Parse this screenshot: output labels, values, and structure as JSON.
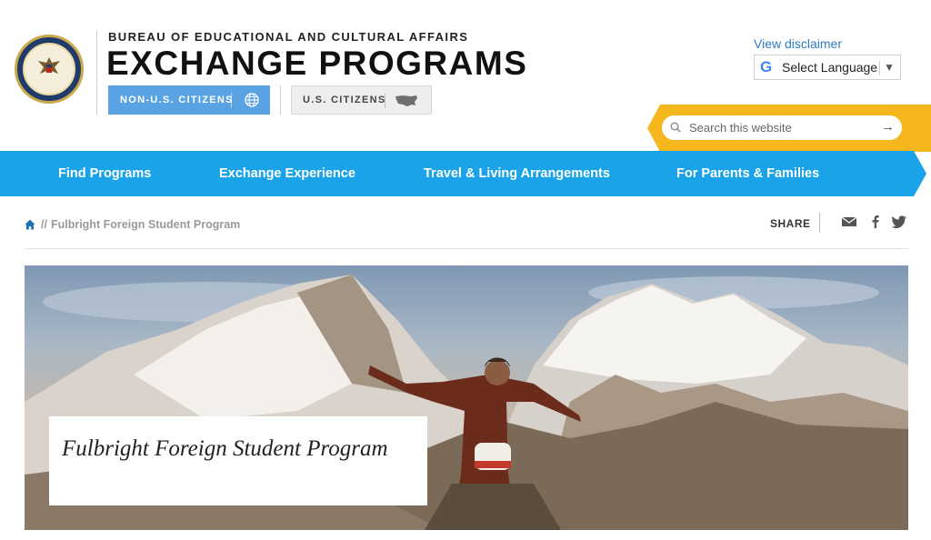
{
  "header": {
    "bureau": "BUREAU OF EDUCATIONAL AND CULTURAL AFFAIRS",
    "title": "EXCHANGE PROGRAMS",
    "audience_buttons": [
      {
        "label": "NON-U.S. CITIZENS",
        "icon": "globe-icon",
        "active": true
      },
      {
        "label": "U.S. CITIZENS",
        "icon": "usa-map-icon",
        "active": false
      }
    ],
    "disclaimer": "View disclaimer",
    "language": {
      "label": "Select Language",
      "icon": "google-icon",
      "arrow": "▼"
    },
    "search": {
      "placeholder": "Search this website",
      "icon": "search-icon",
      "submit_icon": "arrow-right-icon"
    }
  },
  "nav": {
    "items": [
      {
        "label": "Find Programs"
      },
      {
        "label": "Exchange Experience"
      },
      {
        "label": "Travel & Living Arrangements"
      },
      {
        "label": "For Parents & Families"
      }
    ]
  },
  "breadcrumb": {
    "separator": "//",
    "current": "Fulbright Foreign Student Program"
  },
  "share": {
    "label": "SHARE",
    "icons": [
      "email-icon",
      "facebook-icon",
      "twitter-icon"
    ]
  },
  "hero": {
    "title": "Fulbright Foreign Student Program"
  },
  "colors": {
    "nav": "#1aa3e8",
    "accent_yellow": "#f5b71d",
    "non_us_button": "#5aa3e2",
    "link": "#2d7bbf"
  }
}
